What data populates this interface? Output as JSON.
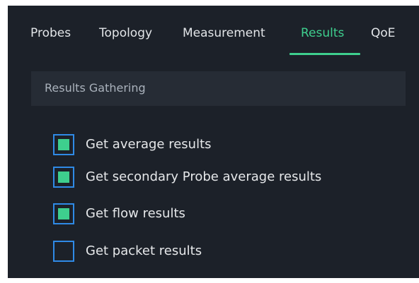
{
  "tabs": [
    {
      "label": "Probes",
      "active": false
    },
    {
      "label": "Topology",
      "active": false
    },
    {
      "label": "Measurement",
      "active": false
    },
    {
      "label": "Results",
      "active": true
    },
    {
      "label": "QoE",
      "active": false
    }
  ],
  "section": {
    "title": "Results Gathering"
  },
  "options": [
    {
      "label": "Get average results",
      "checked": true
    },
    {
      "label": "Get secondary Probe average results",
      "checked": true
    },
    {
      "label": "Get flow results",
      "checked": true
    },
    {
      "label": "Get packet results",
      "checked": false
    }
  ],
  "colors": {
    "background": "#1c2129",
    "section_background": "#262c35",
    "accent": "#3ecf8e",
    "checkbox_border": "#2f8ae6",
    "text": "#e6e8ea",
    "muted_text": "#aab2bc"
  }
}
